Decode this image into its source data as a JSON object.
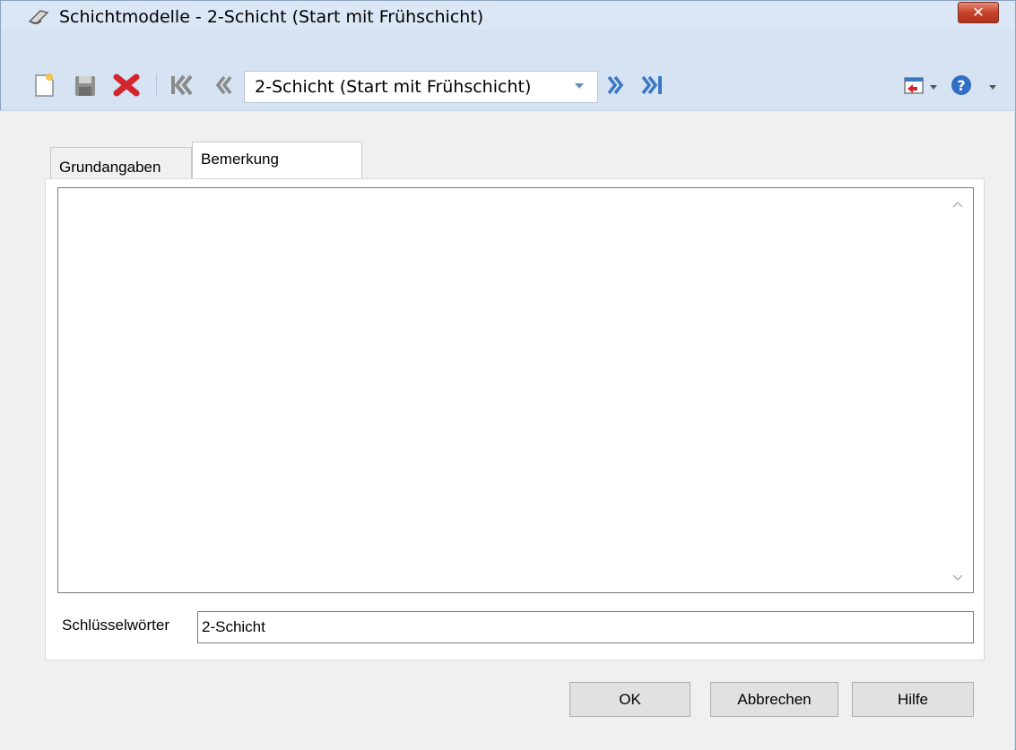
{
  "window": {
    "title": "Schichtmodelle - 2-Schicht (Start mit Frühschicht)",
    "close_label": "✕"
  },
  "toolbar": {
    "record_select": "2-Schicht (Start mit Frühschicht)",
    "icons": [
      "new-document-icon",
      "save-icon",
      "delete-icon",
      "first-record-icon",
      "previous-record-icon",
      "next-record-icon",
      "last-record-icon",
      "exit-icon",
      "help-icon"
    ]
  },
  "tabs": [
    {
      "label": "Grundangaben",
      "active": false
    },
    {
      "label": "Bemerkung",
      "active": true
    }
  ],
  "remark": {
    "text": ""
  },
  "keywords": {
    "label": "Schlüsselwörter",
    "value": "2-Schicht"
  },
  "buttons": {
    "ok": "OK",
    "cancel": "Abbrechen",
    "help": "Hilfe"
  },
  "colors": {
    "accent": "#3b78c4",
    "delete": "#d3262c",
    "titlebar": "#dbe7f5",
    "close": "#c44429"
  }
}
